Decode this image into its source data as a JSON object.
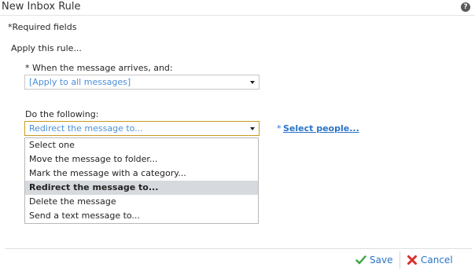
{
  "window": {
    "title": "New Inbox Rule",
    "help_icon": "help-icon",
    "help_glyph": "?"
  },
  "required_note": "*Required fields",
  "apply_heading": "Apply this rule...",
  "condition": {
    "label": "* When the message arrives, and:",
    "value": "[Apply to all messages]"
  },
  "action": {
    "label": "Do the following:",
    "value": "Redirect the message to...",
    "required_marker": "*",
    "select_people_link": "Select people...",
    "options": [
      "Select one",
      "Move the message to folder...",
      "Mark the message with a category...",
      "Redirect the message to...",
      "Delete the message",
      "Send a text message to..."
    ],
    "selected_index": 3
  },
  "footer": {
    "save_label": "Save",
    "cancel_label": "Cancel",
    "save_icon": "check-icon",
    "cancel_icon": "x-icon",
    "accent_color": "#2a73c7",
    "save_icon_color": "#3aa640",
    "cancel_icon_color": "#d9302c"
  }
}
